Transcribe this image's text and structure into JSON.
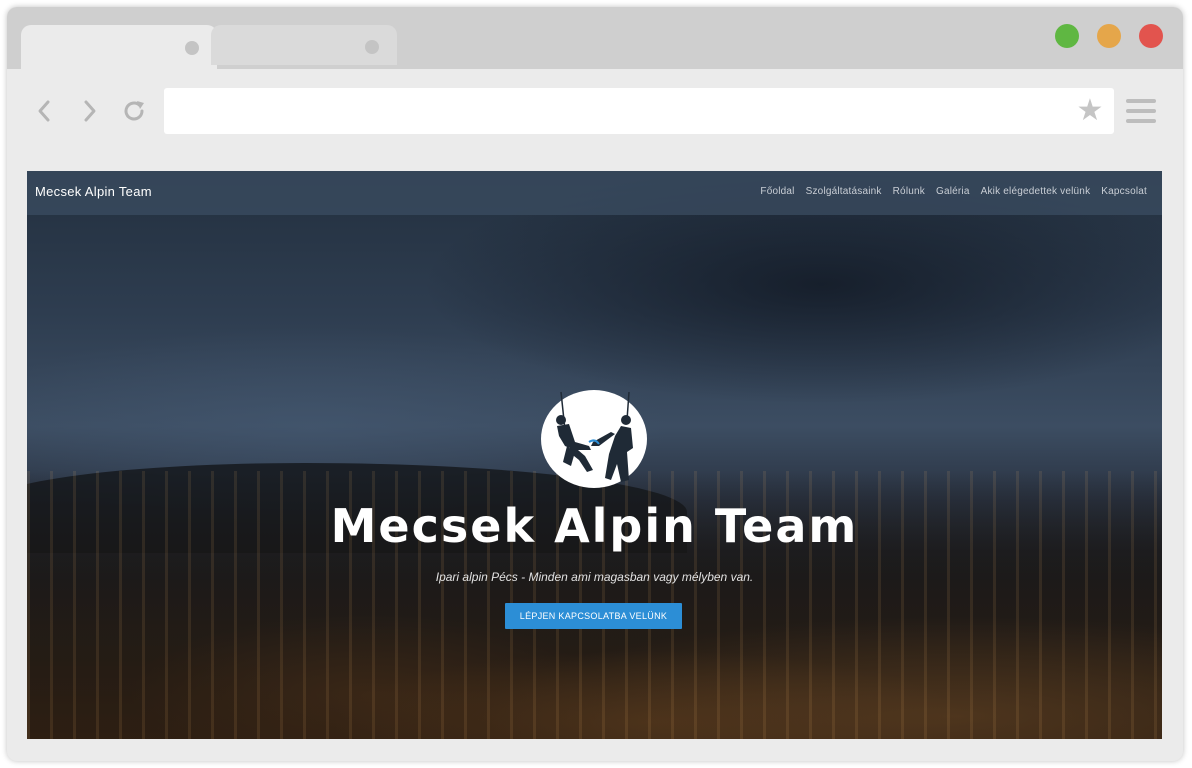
{
  "browser": {
    "address_value": "",
    "traffic_colors": {
      "green": "#5fb742",
      "yellow": "#e5a64a",
      "red": "#e2544e"
    },
    "icons": [
      "back-arrow-icon",
      "forward-arrow-icon",
      "reload-icon",
      "bookmark-star-icon",
      "menu-icon"
    ]
  },
  "site": {
    "brand": "Mecsek Alpin Team",
    "nav": [
      {
        "label": "Főoldal"
      },
      {
        "label": "Szolgáltatásaink"
      },
      {
        "label": "Rólunk"
      },
      {
        "label": "Galéria"
      },
      {
        "label": "Akik elégedettek velünk"
      },
      {
        "label": "Kapcsolat"
      }
    ],
    "hero": {
      "title": "Mecsek Alpin Team",
      "subtitle": "Ipari alpin Pécs - Minden ami magasban vagy mélyben van.",
      "cta_label": "LÉPJEN KAPCSOLATBA VELÜNK"
    },
    "colors": {
      "cta": "#2c8ed6",
      "nav_bg": "#3c4e62"
    }
  }
}
